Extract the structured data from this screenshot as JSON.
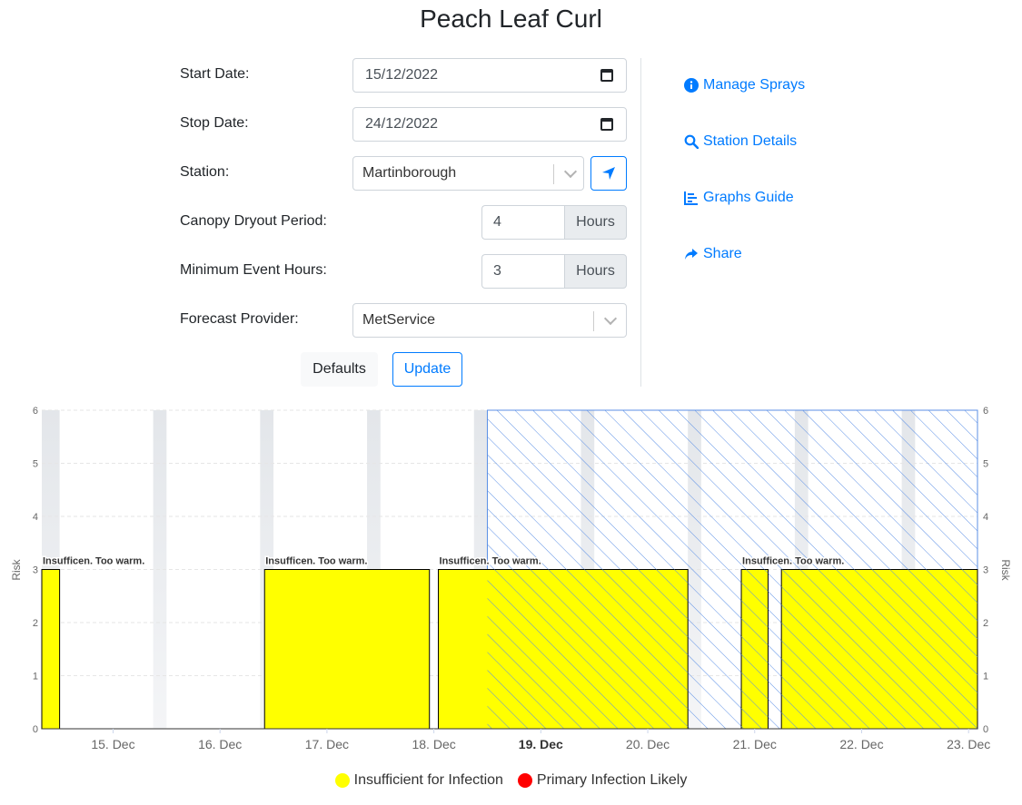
{
  "page": {
    "title": "Peach Leaf Curl"
  },
  "form": {
    "start_date_label": "Start Date:",
    "start_date_value": "15/12/2022",
    "stop_date_label": "Stop Date:",
    "stop_date_value": "24/12/2022",
    "station_label": "Station:",
    "station_value": "Martinborough",
    "canopy_label": "Canopy Dryout Period:",
    "canopy_value": "4",
    "canopy_unit": "Hours",
    "min_event_label": "Minimum Event Hours:",
    "min_event_value": "3",
    "min_event_unit": "Hours",
    "forecast_label": "Forecast Provider:",
    "forecast_value": "MetService",
    "defaults_button": "Defaults",
    "update_button": "Update"
  },
  "side_links": {
    "manage_sprays": "Manage Sprays",
    "station_details": "Station Details",
    "graphs_guide": "Graphs Guide",
    "share": "Share"
  },
  "colors": {
    "accent": "#007bff",
    "insufficient": "#ffff00",
    "primary_infection": "#ff0000",
    "night_band": "#e3e6ea",
    "forecast_hatch": "#5b8fe6"
  },
  "chart_data": {
    "type": "area",
    "ylabel": "Risk",
    "ylabel_right": "Risk",
    "ylim": [
      0,
      6
    ],
    "y_ticks": [
      "0",
      "1",
      "2",
      "3",
      "4",
      "5",
      "6"
    ],
    "xlim": [
      "2022-12-14 20:00",
      "2022-12-23 14:00"
    ],
    "x_ticks": [
      {
        "date": "2022-12-15",
        "label": "15. Dec",
        "bold": false
      },
      {
        "date": "2022-12-16",
        "label": "16. Dec",
        "bold": false
      },
      {
        "date": "2022-12-17",
        "label": "17. Dec",
        "bold": false
      },
      {
        "date": "2022-12-18",
        "label": "18. Dec",
        "bold": false
      },
      {
        "date": "2022-12-19",
        "label": "19. Dec",
        "bold": true
      },
      {
        "date": "2022-12-20",
        "label": "20. Dec",
        "bold": false
      },
      {
        "date": "2022-12-21",
        "label": "21. Dec",
        "bold": false
      },
      {
        "date": "2022-12-22",
        "label": "22. Dec",
        "bold": false
      },
      {
        "date": "2022-12-23",
        "label": "23. Dec",
        "bold": false
      }
    ],
    "night_bands": [
      [
        "2022-12-14 20:00",
        "2022-12-15 00:00"
      ],
      [
        "2022-12-15 21:00",
        "2022-12-16 00:00"
      ],
      [
        "2022-12-16 21:00",
        "2022-12-17 00:00"
      ],
      [
        "2022-12-17 21:00",
        "2022-12-18 00:00"
      ],
      [
        "2022-12-18 21:00",
        "2022-12-19 00:00"
      ],
      [
        "2022-12-19 21:00",
        "2022-12-20 00:00"
      ],
      [
        "2022-12-20 21:00",
        "2022-12-21 00:00"
      ],
      [
        "2022-12-21 21:00",
        "2022-12-22 00:00"
      ],
      [
        "2022-12-22 21:00",
        "2022-12-23 00:00"
      ]
    ],
    "forecast_start": "2022-12-19 00:00",
    "series": [
      {
        "name": "Insufficient for Infection",
        "color": "#ffff00",
        "periods": [
          {
            "start": "2022-12-14 20:00",
            "end": "2022-12-15 00:00",
            "risk": 3,
            "label": "Insufficen. Too warm."
          },
          {
            "start": "2022-12-16 22:00",
            "end": "2022-12-18 11:00",
            "risk": 3,
            "label": "Insufficen. Too warm."
          },
          {
            "start": "2022-12-18 13:00",
            "end": "2022-12-20 21:00",
            "risk": 3,
            "label": "Insufficen. Too warm."
          },
          {
            "start": "2022-12-21 09:00",
            "end": "2022-12-21 15:00",
            "risk": 3,
            "label": "Insufficen. Too warm."
          },
          {
            "start": "2022-12-21 18:00",
            "end": "2022-12-23 14:00",
            "risk": 3,
            "label": ""
          }
        ]
      },
      {
        "name": "Primary Infection Likely",
        "color": "#ff0000",
        "periods": []
      }
    ],
    "grid": true,
    "legend_position": "bottom-center"
  }
}
